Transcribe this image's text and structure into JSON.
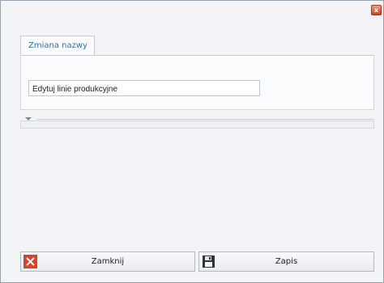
{
  "window": {
    "close_glyph": "x"
  },
  "tab": {
    "label": "Zmiana nazwy"
  },
  "form": {
    "name_value": "Edytuj linie produkcyjne"
  },
  "buttons": {
    "close_label": "Zamknij",
    "save_label": "Zapis"
  },
  "colors": {
    "tab_text": "#2f6fb3",
    "close_red": "#c7422a"
  },
  "icons": {
    "close_icon": "close-x-icon",
    "save_icon": "floppy-disk-icon"
  }
}
